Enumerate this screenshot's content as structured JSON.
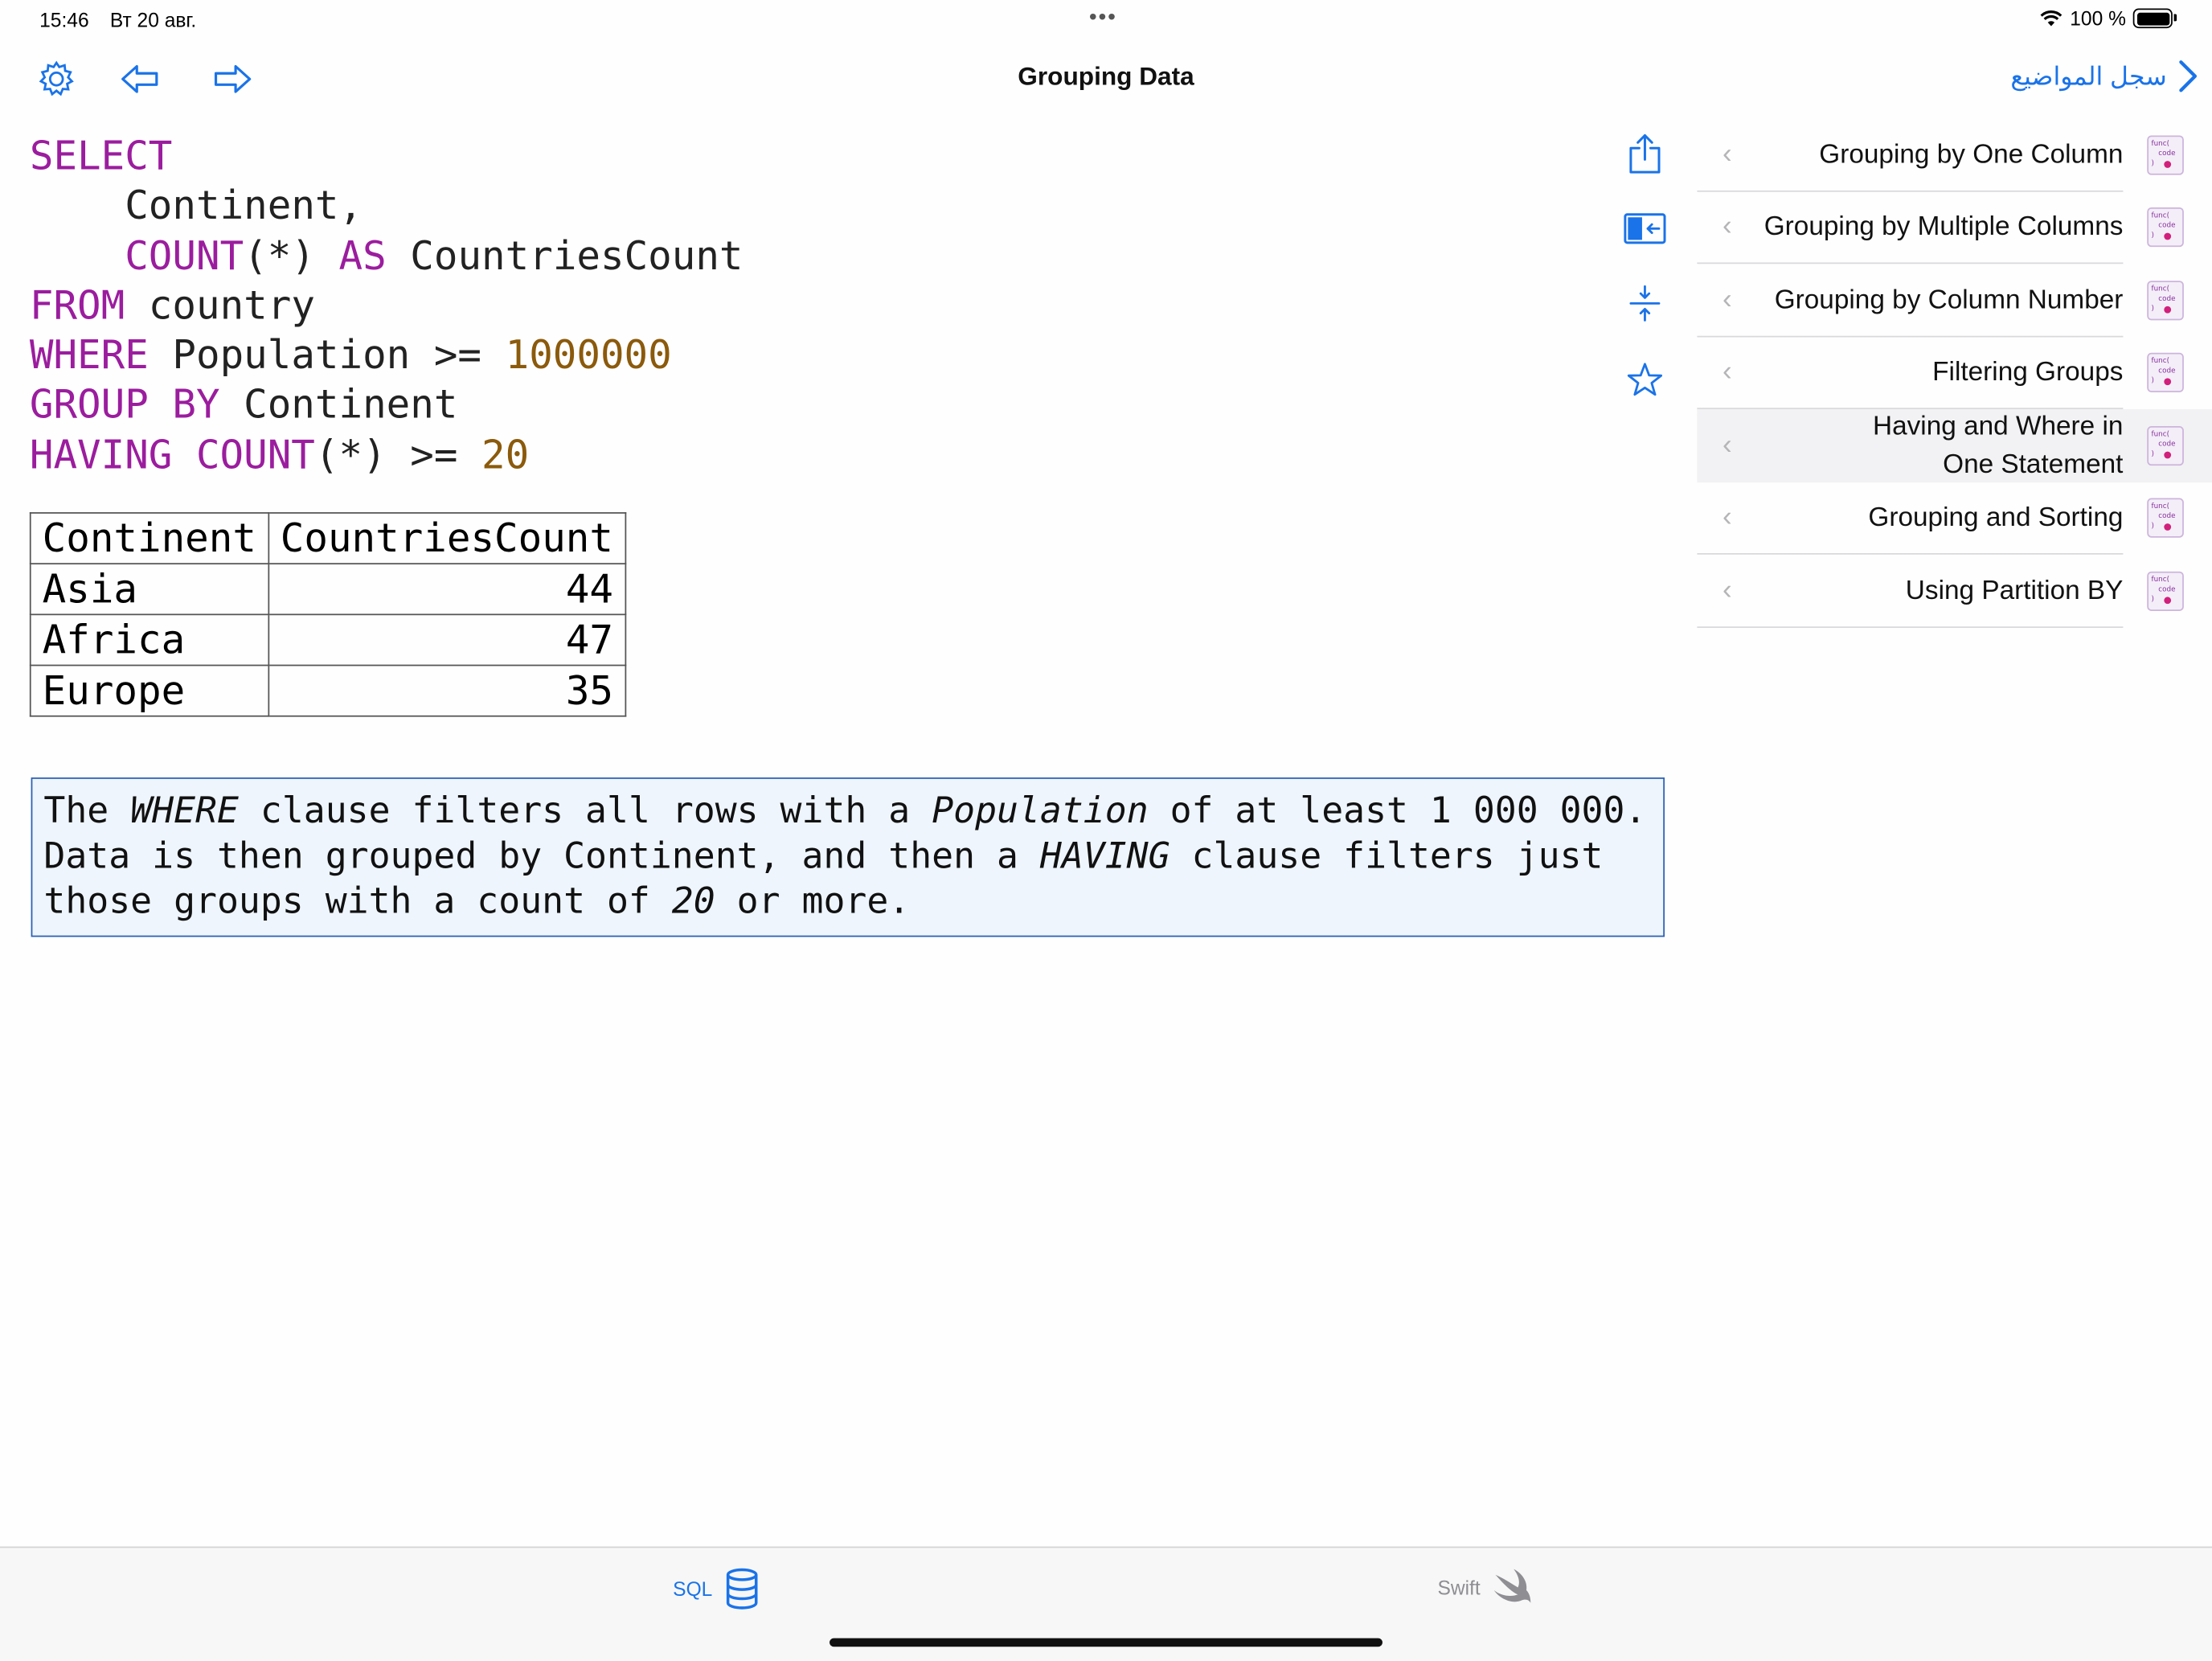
{
  "status_bar": {
    "time": "15:46",
    "date": "Вт 20 авг.",
    "battery": "100 %"
  },
  "navbar": {
    "title": "Grouping Data",
    "back_label": "سجل المواضيع",
    "icons": [
      "gear-icon",
      "back-arrow-icon",
      "forward-arrow-icon",
      "chevron-right-icon"
    ]
  },
  "query": {
    "l1": "SELECT",
    "l2": "Continent,",
    "l3_fn": "COUNT",
    "l3_star": "(*)",
    "l3_as": "AS",
    "l3_alias": "CountriesCount",
    "l4_kw": "FROM",
    "l4_tbl": "country",
    "l5_kw": "WHERE",
    "l5_col": "Population >=",
    "l5_num": "1000000",
    "l6_kw": "GROUP BY",
    "l6_col": "Continent",
    "l7_kw": "HAVING COUNT",
    "l7_rest": "(*) >=",
    "l7_num": "20"
  },
  "result": {
    "columns": [
      "Continent",
      "CountriesCount"
    ],
    "rows": [
      {
        "continent": "Asia",
        "count": "44"
      },
      {
        "continent": "Africa",
        "count": "47"
      },
      {
        "continent": "Europe",
        "count": "35"
      }
    ]
  },
  "explanation": {
    "t1": "The ",
    "t2": "WHERE",
    "t3": " clause filters all rows with a ",
    "t4": "Population",
    "t5": " of at least 1 000 000. Data is then grouped by Continent, and then a ",
    "t6": "HAVING",
    "t7": " clause filters just those groups with a count of ",
    "t8": "20",
    "t9": " or more."
  },
  "side_tools": [
    "share-icon",
    "sidebar-toggle-icon",
    "collapse-icon",
    "star-icon"
  ],
  "topics": [
    {
      "label": "Grouping by One Column",
      "selected": false
    },
    {
      "label": "Grouping by Multiple Columns",
      "selected": false
    },
    {
      "label": "Grouping by Column Number",
      "selected": false
    },
    {
      "label": "Filtering Groups",
      "selected": false
    },
    {
      "label": "Having and Where in One Statement",
      "selected": true
    },
    {
      "label": "Grouping and Sorting",
      "selected": false
    },
    {
      "label": "Using Partition BY",
      "selected": false
    }
  ],
  "topic_icon_text": [
    "func(",
    "code",
    ")"
  ],
  "tabs": [
    {
      "label": "SQL",
      "active": true,
      "icon": "database-icon"
    },
    {
      "label": "Swift",
      "active": false,
      "icon": "swift-bird-icon"
    }
  ],
  "colors": {
    "accent": "#1a73e8",
    "keyword": "#9b1d9e",
    "number": "#8b5a0b",
    "note_bg": "#eef5fd",
    "note_border": "#2b60b5"
  }
}
